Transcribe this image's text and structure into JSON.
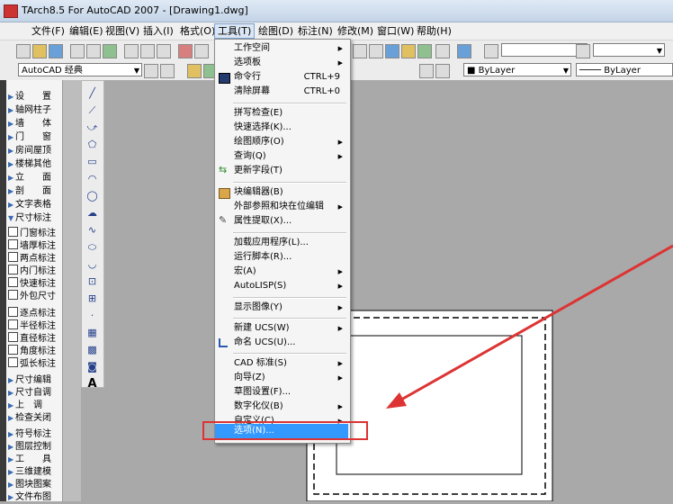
{
  "window": {
    "title": "TArch8.5 For AutoCAD 2007 - [Drawing1.dwg]"
  },
  "menubar": [
    {
      "label": "文件(F)"
    },
    {
      "label": "编辑(E)"
    },
    {
      "label": "视图(V)"
    },
    {
      "label": "插入(I)"
    },
    {
      "label": "格式(O)"
    },
    {
      "label": "工具(T)"
    },
    {
      "label": "绘图(D)"
    },
    {
      "label": "标注(N)"
    },
    {
      "label": "修改(M)"
    },
    {
      "label": "窗口(W)"
    },
    {
      "label": "帮助(H)"
    }
  ],
  "toolbar2": {
    "workspace_combo": "AutoCAD 经典",
    "layer_combo": "ByLayer",
    "linetype_combo": "ByLayer"
  },
  "left_panel": [
    "设　　置",
    "轴网柱子",
    "墙　　体",
    "门　　窗",
    "房间屋顶",
    "楼梯其他",
    "立　　面",
    "剖　　面",
    "文字表格",
    "尺寸标注",
    "门窗标注",
    "墙厚标注",
    "两点标注",
    "内门标注",
    "快速标注",
    "外包尺寸",
    "逐点标注",
    "半径标注",
    "直径标注",
    "角度标注",
    "弧长标注",
    "尺寸编辑",
    "尺寸自调",
    "上　调",
    "检查关闭",
    "符号标注",
    "图层控制",
    "工　　具",
    "三维建模",
    "图块图案",
    "文件布图"
  ],
  "tools_menu": {
    "items": [
      {
        "label": "工作空间",
        "submenu": true
      },
      {
        "label": "选项板",
        "submenu": true
      },
      {
        "label": "命令行",
        "shortcut": "CTRL+9"
      },
      {
        "label": "清除屏幕",
        "shortcut": "CTRL+0"
      },
      {
        "label": "拼写检查(E)"
      },
      {
        "label": "快速选择(K)..."
      },
      {
        "label": "绘图顺序(O)",
        "submenu": true
      },
      {
        "label": "查询(Q)",
        "submenu": true
      },
      {
        "label": "更新字段(T)"
      },
      {
        "label": "块编辑器(B)"
      },
      {
        "label": "外部参照和块在位编辑",
        "submenu": true
      },
      {
        "label": "属性提取(X)..."
      },
      {
        "label": "加载应用程序(L)..."
      },
      {
        "label": "运行脚本(R)..."
      },
      {
        "label": "宏(A)",
        "submenu": true
      },
      {
        "label": "AutoLISP(S)",
        "submenu": true
      },
      {
        "label": "显示图像(Y)",
        "submenu": true
      },
      {
        "label": "新建 UCS(W)",
        "submenu": true
      },
      {
        "label": "命名 UCS(U)..."
      },
      {
        "label": "CAD 标准(S)",
        "submenu": true
      },
      {
        "label": "向导(Z)",
        "submenu": true
      },
      {
        "label": "草图设置(F)..."
      },
      {
        "label": "数字化仪(B)",
        "submenu": true
      },
      {
        "label": "自定义(C)",
        "submenu": true
      },
      {
        "label": "选项(N)...",
        "highlighted": true
      }
    ]
  },
  "colors": {
    "highlight": "#3399ff",
    "annotation_red": "#dd3333",
    "canvas": "#a9a9a9"
  }
}
